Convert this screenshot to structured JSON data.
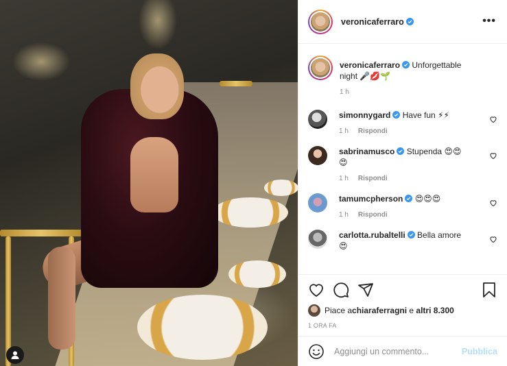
{
  "post": {
    "author": "veronicaferraro",
    "caption_text": "Unforgettable night",
    "caption_emojis": "🎤💋🌱",
    "caption_time": "1 h"
  },
  "comments": [
    {
      "user": "simonnygard",
      "verified": true,
      "text": "Have fun",
      "emojis": "⚡⚡",
      "time": "1 h",
      "reply": "Rispondi"
    },
    {
      "user": "sabrinamusco",
      "verified": true,
      "text": "Stupenda",
      "emojis": "😍😍😍",
      "time": "1 h",
      "reply": "Rispondi"
    },
    {
      "user": "tamumcpherson",
      "verified": true,
      "text": "",
      "emojis": "😍😍😍",
      "time": "1 h",
      "reply": "Rispondi"
    },
    {
      "user": "carlotta.rubaltelli",
      "verified": true,
      "text": "Bella amore",
      "emojis": "😍",
      "time": "",
      "reply": ""
    }
  ],
  "likes": {
    "prefix": "Piace a ",
    "user": "chiaraferragni",
    "middle": " e ",
    "others": "altri 8.300"
  },
  "timestamp": "1 ORA FA",
  "add_comment": {
    "placeholder": "Aggiungi un commento...",
    "publish": "Pubblica"
  },
  "colors": {
    "verified": "#3897f0",
    "publish": "#b2dffc",
    "meta": "#8e8e8e"
  },
  "icons": [
    "more-icon",
    "heart-icon",
    "comment-icon",
    "share-icon",
    "bookmark-icon",
    "emoji-icon",
    "user-tag-icon",
    "verified-icon"
  ]
}
